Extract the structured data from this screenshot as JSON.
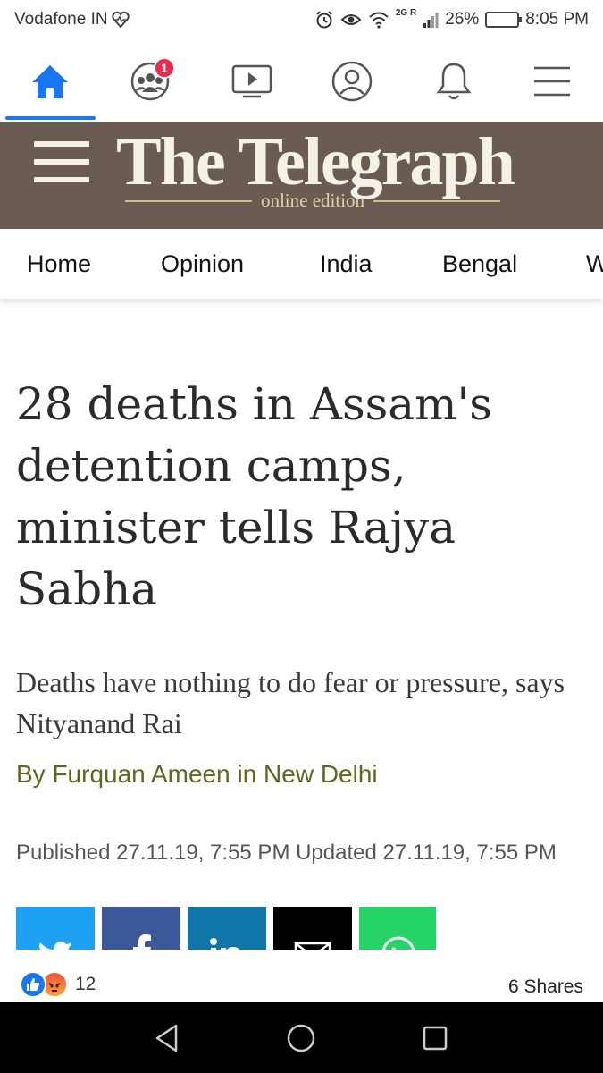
{
  "status_bar": {
    "carrier": "Vodafone IN",
    "network": "2G R",
    "battery": "26%",
    "time": "8:05 PM"
  },
  "fb_nav": {
    "items": [
      "home-icon",
      "groups-icon",
      "watch-icon",
      "profile-icon",
      "notifications-icon",
      "menu-icon"
    ],
    "groups_badge": "1",
    "active": "home",
    "accent_color": "#1877f2"
  },
  "site": {
    "title": "The Telegraph",
    "subtitle": "online edition",
    "header_color": "#6a5c52"
  },
  "sections": [
    "Home",
    "Opinion",
    "India",
    "Bengal",
    "W"
  ],
  "article": {
    "headline": "28 deaths in Assam's detention camps, minister tells Rajya Sabha",
    "standfirst": "Deaths have nothing to do fear or pressure, says Nityanand Rai",
    "byline": "By Furquan Ameen in New Delhi",
    "dates": "Published 27.11.19, 7:55 PM Updated 27.11.19, 7:55 PM"
  },
  "share_buttons": [
    {
      "icon": "twitter-icon",
      "color": "#1da1f2"
    },
    {
      "icon": "facebook-icon",
      "color": "#3b5998"
    },
    {
      "icon": "linkedin-icon",
      "color": "#0e76a8"
    },
    {
      "icon": "email-icon",
      "color": "#000000"
    },
    {
      "icon": "whatsapp-icon",
      "color": "#25d366"
    }
  ],
  "engagement": {
    "reactions_count": "12",
    "shares": "6 Shares"
  },
  "android_nav": [
    "back-icon",
    "home-circle-icon",
    "recents-icon"
  ]
}
